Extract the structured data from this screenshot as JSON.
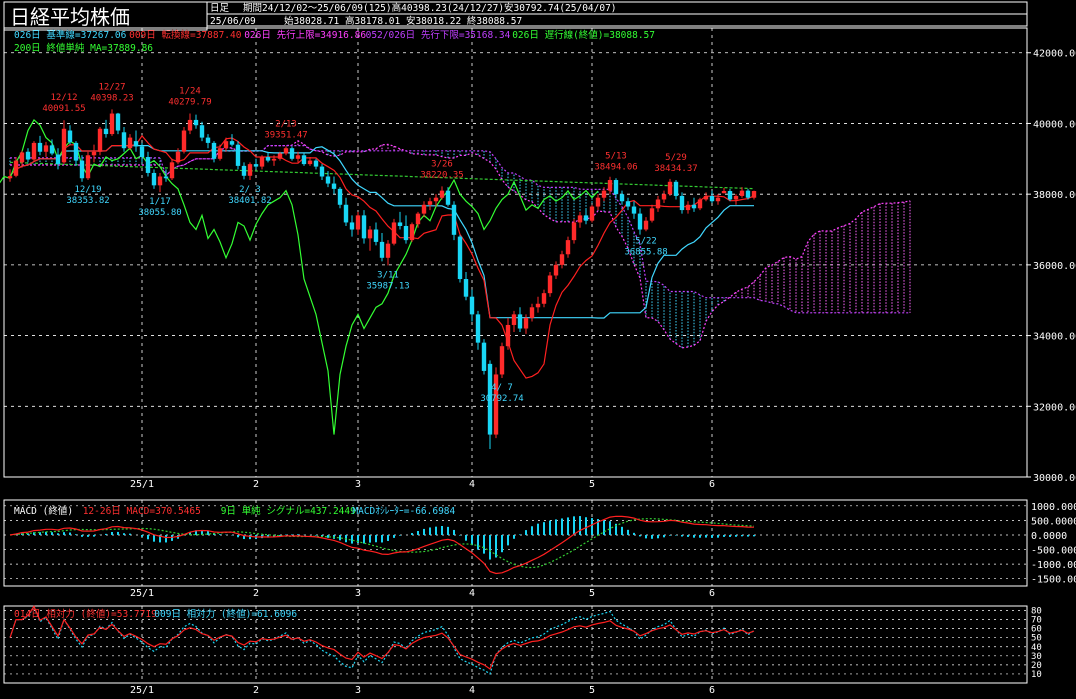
{
  "header": {
    "title": "日経平均株価",
    "period_type": "日足",
    "period_info": "期間24/12/02〜25/06/09(125)高40398.23(24/12/27)安30792.74(25/04/07)",
    "date": "25/06/09",
    "ohlc": "始38028.71 高38178.01 安38018.22 終38088.57"
  },
  "colors": {
    "background": "#000000",
    "up_candle": "#ff2a2a",
    "down_candle": "#19d6f5",
    "tenkan": "#ff2020",
    "kijun": "#40d8ff",
    "senkou_a": "#ff40ff",
    "senkou_b": "#c040ff",
    "chikou": "#33ff33",
    "ma200": "#33cc33",
    "grid": "#ffffff",
    "macd": "#ff2020",
    "signal": "#33cc33",
    "osc": "#19d6f5",
    "rsi14": "#ff2020",
    "rsi9": "#19d6f5"
  },
  "legend": {
    "line1": [
      {
        "text": "026日 基準線=37267.06",
        "color": "#40d8ff"
      },
      {
        "text": "009日 転換線=37887.40",
        "color": "#ff3030"
      },
      {
        "text": "026日 先行上限=34916.86",
        "color": "#ff40ff"
      },
      {
        "text": "052/026日 先行下限=35168.34",
        "color": "#c040ff"
      },
      {
        "text": "026日 遅行線(終値)=38088.57",
        "color": "#33ff33"
      }
    ],
    "line2": [
      {
        "text": "200日 終値単純 MA=37889.86",
        "color": "#33ff33"
      }
    ]
  },
  "annotations": [
    {
      "text": "12/12",
      "color": "#ff3030"
    },
    {
      "text": "40091.55",
      "color": "#ff3030"
    },
    {
      "text": "12/27",
      "color": "#ff3030"
    },
    {
      "text": "40398.23",
      "color": "#ff3030"
    },
    {
      "text": "1/24",
      "color": "#ff3030"
    },
    {
      "text": "40279.79",
      "color": "#ff3030"
    },
    {
      "text": "2/13",
      "color": "#ff3030"
    },
    {
      "text": "39351.47",
      "color": "#ff3030"
    },
    {
      "text": "3/26",
      "color": "#ff3030"
    },
    {
      "text": "38220.35",
      "color": "#ff3030"
    },
    {
      "text": "5/13",
      "color": "#ff3030"
    },
    {
      "text": "38494.06",
      "color": "#ff3030"
    },
    {
      "text": "5/29",
      "color": "#ff3030"
    },
    {
      "text": "38434.37",
      "color": "#ff3030"
    },
    {
      "text": "12/19",
      "color": "#40d8ff"
    },
    {
      "text": "38353.82",
      "color": "#40d8ff"
    },
    {
      "text": "1/17",
      "color": "#40d8ff"
    },
    {
      "text": "38055.80",
      "color": "#40d8ff"
    },
    {
      "text": "2/ 3",
      "color": "#40d8ff"
    },
    {
      "text": "38401.82",
      "color": "#40d8ff"
    },
    {
      "text": "3/11",
      "color": "#40d8ff"
    },
    {
      "text": "35987.13",
      "color": "#40d8ff"
    },
    {
      "text": "4/ 7",
      "color": "#40d8ff"
    },
    {
      "text": "30792.74",
      "color": "#40d8ff"
    },
    {
      "text": "5/22",
      "color": "#40d8ff"
    },
    {
      "text": "36855.88",
      "color": "#40d8ff"
    }
  ],
  "macd_header": [
    {
      "text": "MACD (終値)",
      "color": "#ffffff"
    },
    {
      "text": "12-26日 MACD=370.5465",
      "color": "#ff3030"
    },
    {
      "text": "9日 単純 シグナル=437.2449",
      "color": "#33ff33"
    },
    {
      "text": "MACDｵｼﾚｰﾀｰ=-66.6984",
      "color": "#40d8ff"
    }
  ],
  "rsi_header": [
    {
      "text": "014日 相対力 (終値)=53.7719",
      "color": "#ff3030"
    },
    {
      "text": "009日 相対力 (終値)=61.6096",
      "color": "#40d8ff"
    }
  ],
  "chart_data": [
    {
      "type": "candlestick",
      "title": "日経平均株価",
      "yticks": [
        "42000.00",
        "40000.00",
        "38000.00",
        "36000.00",
        "34000.00",
        "32000.00",
        "30000.00"
      ],
      "ylim": [
        30000,
        42700
      ],
      "x_labels": [
        "25/1",
        "2",
        "3",
        "4",
        "5",
        "6"
      ],
      "x_label_index": [
        22,
        41,
        58,
        77,
        97,
        117
      ],
      "n_days": 125,
      "ohlc": [
        [
          38450,
          38700,
          38350,
          38510
        ],
        [
          38520,
          39050,
          38480,
          38950
        ],
        [
          38900,
          39230,
          38750,
          39180
        ],
        [
          39200,
          39300,
          38900,
          38980
        ],
        [
          38980,
          39500,
          38920,
          39450
        ],
        [
          39450,
          39650,
          39100,
          39200
        ],
        [
          39200,
          39480,
          39050,
          39380
        ],
        [
          39380,
          39550,
          39100,
          39150
        ],
        [
          39120,
          39300,
          38700,
          38850
        ],
        [
          38900,
          40091,
          38850,
          39850
        ],
        [
          39800,
          39950,
          39400,
          39470
        ],
        [
          39450,
          39500,
          38800,
          38950
        ],
        [
          38950,
          39100,
          38350,
          38450
        ],
        [
          38450,
          39200,
          38400,
          39100
        ],
        [
          39100,
          39400,
          38900,
          39200
        ],
        [
          39200,
          39900,
          39100,
          39850
        ],
        [
          39850,
          40100,
          39600,
          39700
        ],
        [
          39700,
          40398,
          39650,
          40280
        ],
        [
          40280,
          40300,
          39700,
          39800
        ],
        [
          39750,
          39900,
          39200,
          39300
        ],
        [
          39300,
          39700,
          39250,
          39600
        ],
        [
          39500,
          39800,
          39200,
          39350
        ],
        [
          39350,
          39450,
          38900,
          39050
        ],
        [
          39050,
          39200,
          38500,
          38600
        ],
        [
          38600,
          38700,
          38150,
          38250
        ],
        [
          38250,
          38600,
          38056,
          38500
        ],
        [
          38500,
          38700,
          38350,
          38450
        ],
        [
          38450,
          39000,
          38400,
          38900
        ],
        [
          38900,
          39300,
          38850,
          39200
        ],
        [
          39200,
          39900,
          39150,
          39800
        ],
        [
          39800,
          40280,
          39700,
          40100
        ],
        [
          40100,
          40250,
          39850,
          39950
        ],
        [
          39950,
          40050,
          39500,
          39600
        ],
        [
          39600,
          39700,
          39300,
          39450
        ],
        [
          39450,
          39500,
          38900,
          39000
        ],
        [
          39000,
          39400,
          38950,
          39300
        ],
        [
          39300,
          39600,
          39200,
          39500
        ],
        [
          39500,
          39700,
          39350,
          39400
        ],
        [
          39400,
          39500,
          38700,
          38800
        ],
        [
          38800,
          38900,
          38420,
          38520
        ],
        [
          38520,
          38900,
          38402,
          38850
        ],
        [
          38850,
          39000,
          38700,
          38780
        ],
        [
          38780,
          39100,
          38700,
          39050
        ],
        [
          39050,
          39200,
          38900,
          38950
        ],
        [
          38950,
          39100,
          38800,
          39000
        ],
        [
          39000,
          39200,
          38950,
          39150
        ],
        [
          39150,
          39352,
          39100,
          39300
        ],
        [
          39300,
          39350,
          38950,
          39000
        ],
        [
          39000,
          39200,
          38900,
          39100
        ],
        [
          39100,
          39150,
          38800,
          38850
        ],
        [
          38850,
          39050,
          38800,
          38950
        ],
        [
          38950,
          39000,
          38700,
          38780
        ],
        [
          38780,
          38850,
          38400,
          38500
        ],
        [
          38500,
          38650,
          38200,
          38300
        ],
        [
          38300,
          38500,
          38000,
          38150
        ],
        [
          38150,
          38200,
          37600,
          37700
        ],
        [
          37700,
          37900,
          37100,
          37200
        ],
        [
          37200,
          37400,
          36800,
          37000
        ],
        [
          37000,
          37500,
          36850,
          37400
        ],
        [
          37400,
          37550,
          36600,
          36750
        ],
        [
          36750,
          37100,
          36400,
          37000
        ],
        [
          37000,
          37200,
          36550,
          36650
        ],
        [
          36650,
          36900,
          36100,
          36200
        ],
        [
          36200,
          36700,
          35987,
          36600
        ],
        [
          36600,
          37300,
          36550,
          37200
        ],
        [
          37200,
          37500,
          37000,
          37100
        ],
        [
          37100,
          37400,
          36600,
          36700
        ],
        [
          36700,
          37200,
          36650,
          37150
        ],
        [
          37150,
          37500,
          37050,
          37450
        ],
        [
          37450,
          37800,
          37350,
          37700
        ],
        [
          37700,
          37900,
          37550,
          37800
        ],
        [
          37800,
          38000,
          37650,
          37900
        ],
        [
          37900,
          38220,
          37850,
          38100
        ],
        [
          38100,
          38200,
          37650,
          37700
        ],
        [
          37700,
          37800,
          36700,
          36850
        ],
        [
          36800,
          36850,
          35500,
          35600
        ],
        [
          35600,
          35800,
          35000,
          35100
        ],
        [
          35100,
          35300,
          34400,
          34600
        ],
        [
          34600,
          34700,
          33600,
          33800
        ],
        [
          33800,
          33900,
          32900,
          33000
        ],
        [
          33200,
          33300,
          30793,
          31200
        ],
        [
          31200,
          33100,
          31100,
          32900
        ],
        [
          32900,
          33800,
          32800,
          33700
        ],
        [
          33700,
          34500,
          33600,
          34300
        ],
        [
          34300,
          34700,
          34100,
          34600
        ],
        [
          34600,
          34800,
          34100,
          34200
        ],
        [
          34200,
          34600,
          34050,
          34500
        ],
        [
          34500,
          34900,
          34400,
          34800
        ],
        [
          34800,
          35100,
          34650,
          34900
        ],
        [
          34900,
          35300,
          34800,
          35200
        ],
        [
          35200,
          35800,
          35100,
          35700
        ],
        [
          35700,
          36100,
          35600,
          36000
        ],
        [
          36000,
          36400,
          35900,
          36300
        ],
        [
          36300,
          36800,
          36200,
          36700
        ],
        [
          36700,
          37300,
          36600,
          37200
        ],
        [
          37200,
          37500,
          37050,
          37400
        ],
        [
          37400,
          37600,
          37150,
          37250
        ],
        [
          37250,
          37700,
          37200,
          37650
        ],
        [
          37650,
          38000,
          37550,
          37900
        ],
        [
          37900,
          38200,
          37800,
          38100
        ],
        [
          38100,
          38494,
          38000,
          38400
        ],
        [
          38400,
          38450,
          37900,
          38000
        ],
        [
          38000,
          38100,
          37700,
          37800
        ],
        [
          37800,
          37900,
          37550,
          37650
        ],
        [
          37650,
          37800,
          37300,
          37450
        ],
        [
          37450,
          37600,
          36856,
          37000
        ],
        [
          37000,
          37350,
          36950,
          37250
        ],
        [
          37250,
          37700,
          37200,
          37600
        ],
        [
          37600,
          37950,
          37500,
          37850
        ],
        [
          37850,
          38100,
          37750,
          38000
        ],
        [
          38000,
          38434,
          37950,
          38350
        ],
        [
          38350,
          38400,
          37850,
          37950
        ],
        [
          37950,
          38050,
          37450,
          37550
        ],
        [
          37550,
          37800,
          37450,
          37700
        ],
        [
          37700,
          37900,
          37500,
          37600
        ],
        [
          37600,
          37900,
          37550,
          37850
        ],
        [
          37850,
          38050,
          37800,
          37950
        ],
        [
          37950,
          38100,
          37750,
          37800
        ],
        [
          37800,
          38000,
          37700,
          37900
        ],
        [
          38029,
          38178,
          38018,
          38089
        ],
        [
          38089,
          38150,
          37800,
          37850
        ],
        [
          37850,
          38000,
          37700,
          37950
        ],
        [
          37950,
          38200,
          37900,
          38100
        ],
        [
          38100,
          38150,
          37850,
          37900
        ],
        [
          37900,
          38100,
          37850,
          38089
        ]
      ]
    },
    {
      "type": "line",
      "title": "MACD (終値)",
      "yticks": [
        "1000.0000",
        "500.0000",
        "0.0000",
        "-500.0000",
        "-1000.0000",
        "-1500.0000"
      ],
      "ylim": [
        -1750,
        1200
      ]
    },
    {
      "type": "line",
      "title": "相対力 (終値)",
      "yticks": [
        "80",
        "70",
        "60",
        "50",
        "40",
        "30",
        "20",
        "10"
      ],
      "ylim": [
        0,
        85
      ]
    }
  ]
}
